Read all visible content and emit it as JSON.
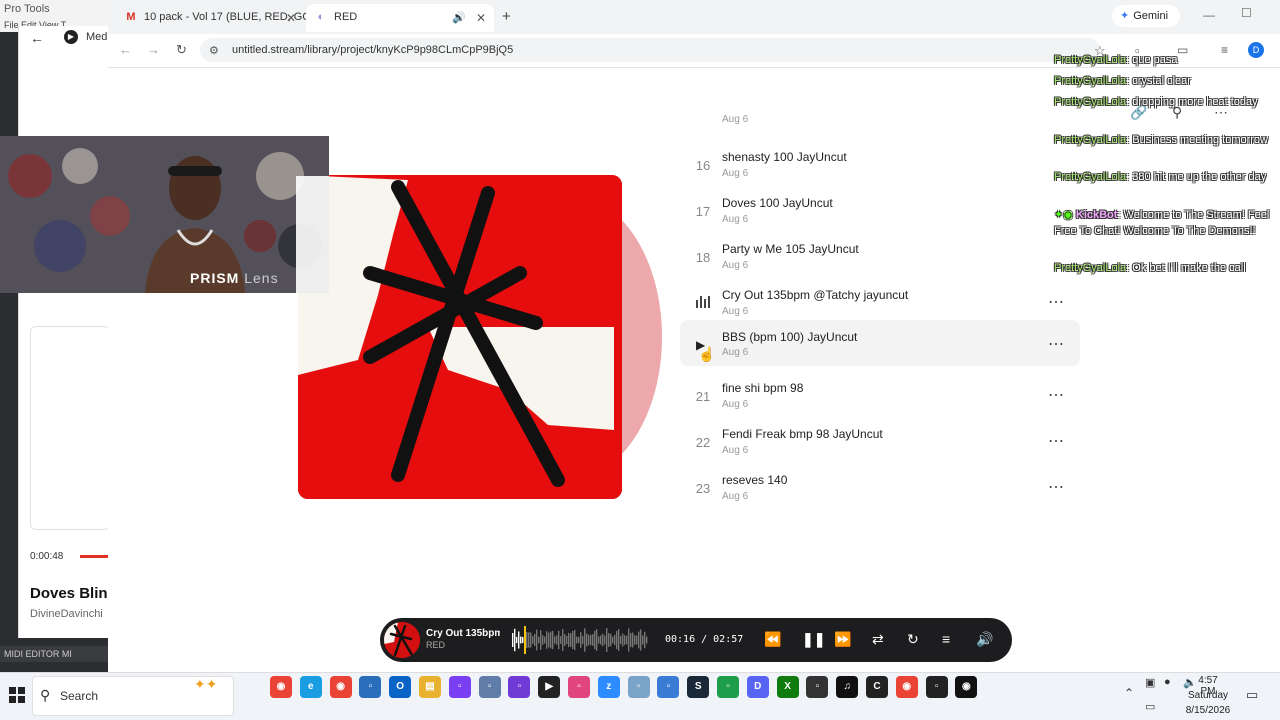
{
  "background_app": {
    "title": "Pro Tools",
    "menu": "File  Edit  View  T",
    "media_label": "Med",
    "time": "0:00:48",
    "song": "Doves Blin",
    "artist": "DivineDavinchi",
    "bottom_label": "MIDI EDITOR   MI"
  },
  "browser": {
    "tabs": [
      {
        "label": "10 pack - Vol 17 (BLUE, RED, GO",
        "icon": "gmail-icon"
      },
      {
        "label": "RED",
        "icon": "untitled-stream-icon",
        "active": true
      }
    ],
    "gemini_label": "Gemini",
    "url": "untitled.stream/library/project/knyKcP9p98CLmCpP9BjQ5",
    "profile_initial": "D"
  },
  "tracks": [
    {
      "num": "",
      "title": "",
      "date": "Aug 6"
    },
    {
      "num": "16",
      "title": "shenasty 100 JayUncut",
      "date": "Aug 6"
    },
    {
      "num": "17",
      "title": "Doves 100 JayUncut",
      "date": "Aug 6"
    },
    {
      "num": "18",
      "title": "Party w Me 105 JayUncut",
      "date": "Aug 6"
    },
    {
      "num": "",
      "title": "Cry Out 135bpm @Tatchy jayuncut",
      "date": "Aug 6",
      "playing": true
    },
    {
      "num": "",
      "title": "BBS (bpm 100) JayUncut",
      "date": "Aug 6",
      "hover": true
    },
    {
      "num": "21",
      "title": "fine shi bpm 98",
      "date": "Aug 6"
    },
    {
      "num": "22",
      "title": "Fendi Freak bmp 98 JayUncut",
      "date": "Aug 6"
    },
    {
      "num": "23",
      "title": "reseves 140",
      "date": "Aug 6"
    }
  ],
  "chat": [
    {
      "user": "PrettyGyalLola",
      "text": ": que pasa"
    },
    {
      "user": "PrettyGyalLola",
      "text": ": crystal clear"
    },
    {
      "user": "PrettyGyalLola",
      "text": ": dropping more heat today"
    },
    {
      "user": "PrettyGyalLola",
      "text": ": Business meeting tomorrow"
    },
    {
      "user": "PrettyGyalLola",
      "text": ": 380 hit me up the other day"
    },
    {
      "user": "KickBot",
      "text": ": Welcome to The Stream! Feel Free To Chat! Welcome To The Demons!!",
      "bot": true
    },
    {
      "user": "PrettyGyalLola",
      "text": ": Ok bet I'll make the call"
    }
  ],
  "webcam": {
    "brand": "PRISM",
    "brand_suffix": " Lens"
  },
  "player": {
    "title": "Cry Out 135bpm",
    "subtitle": "RED",
    "time": "00:16 / 02:57",
    "progress": 0.09
  },
  "taskbar": {
    "search_label": "Search",
    "apps": [
      {
        "icon": "chrome-icon",
        "color": "#ea4335"
      },
      {
        "icon": "edge-icon",
        "color": "#1b9de2"
      },
      {
        "icon": "chrome-icon",
        "color": "#ea4335"
      },
      {
        "icon": "app-icon",
        "color": "#2a6ebb"
      },
      {
        "icon": "outlook-icon",
        "color": "#0a64c8"
      },
      {
        "icon": "folder-icon",
        "color": "#e8b130"
      },
      {
        "icon": "app-icon",
        "color": "#7a3ff2"
      },
      {
        "icon": "app-icon",
        "color": "#5f7da8"
      },
      {
        "icon": "app-icon",
        "color": "#6f3ad6"
      },
      {
        "icon": "media-player-icon",
        "color": "#222222"
      },
      {
        "icon": "app-icon",
        "color": "#e0457b"
      },
      {
        "icon": "zoom-icon",
        "color": "#2d8cff"
      },
      {
        "icon": "app-icon",
        "color": "#7aa3c8"
      },
      {
        "icon": "app-icon",
        "color": "#3a7bd5"
      },
      {
        "icon": "steam-icon",
        "color": "#1b2838"
      },
      {
        "icon": "app-icon",
        "color": "#1e9e4a"
      },
      {
        "icon": "discord-icon",
        "color": "#5865f2"
      },
      {
        "icon": "xbox-icon",
        "color": "#107c10"
      },
      {
        "icon": "app-icon",
        "color": "#333333"
      },
      {
        "icon": "tiktok-icon",
        "color": "#111111"
      },
      {
        "icon": "capcut-icon",
        "color": "#222222"
      },
      {
        "icon": "chrome-icon",
        "color": "#ea4335"
      },
      {
        "icon": "app-icon",
        "color": "#222222"
      },
      {
        "icon": "pro-tools-icon",
        "color": "#111111"
      }
    ],
    "clock_time": "4:57 PM",
    "clock_day": "Saturday",
    "clock_date": "8/15/2026"
  }
}
